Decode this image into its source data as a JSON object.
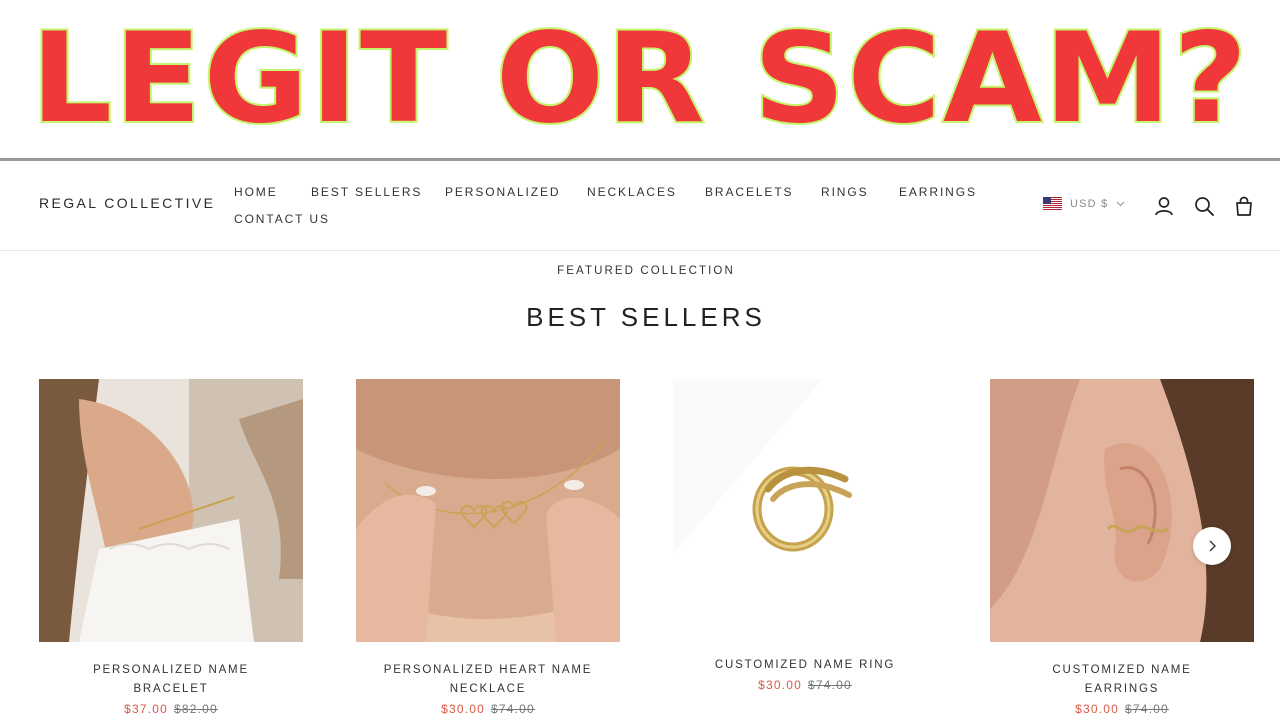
{
  "banner": {
    "title": "LEGIT OR SCAM?"
  },
  "header": {
    "brand": "REGAL COLLECTIVE",
    "nav": [
      "HOME",
      "BEST SELLERS",
      "PERSONALIZED",
      "NECKLACES",
      "BRACELETS",
      "RINGS",
      "EARRINGS",
      "CONTACT US"
    ],
    "currency": "USD $",
    "icons": [
      "us-flag-icon",
      "chevron-down-icon",
      "account-icon",
      "search-icon",
      "cart-icon"
    ]
  },
  "section": {
    "kicker": "FEATURED COLLECTION",
    "title": "BEST SELLERS"
  },
  "products": [
    {
      "name": "PERSONALIZED NAME BRACELET",
      "price": "$37.00",
      "compare": "$82.00"
    },
    {
      "name": "PERSONALIZED HEART NAME NECKLACE",
      "price": "$30.00",
      "compare": "$74.00"
    },
    {
      "name": "CUSTOMIZED NAME RING",
      "price": "$30.00",
      "compare": "$74.00"
    },
    {
      "name": "CUSTOMIZED NAME EARRINGS",
      "price": "$30.00",
      "compare": "$74.00"
    }
  ],
  "colors": {
    "banner_text": "#f0373a",
    "banner_outline": "#c5f56a",
    "sale_price": "#d95a47"
  }
}
